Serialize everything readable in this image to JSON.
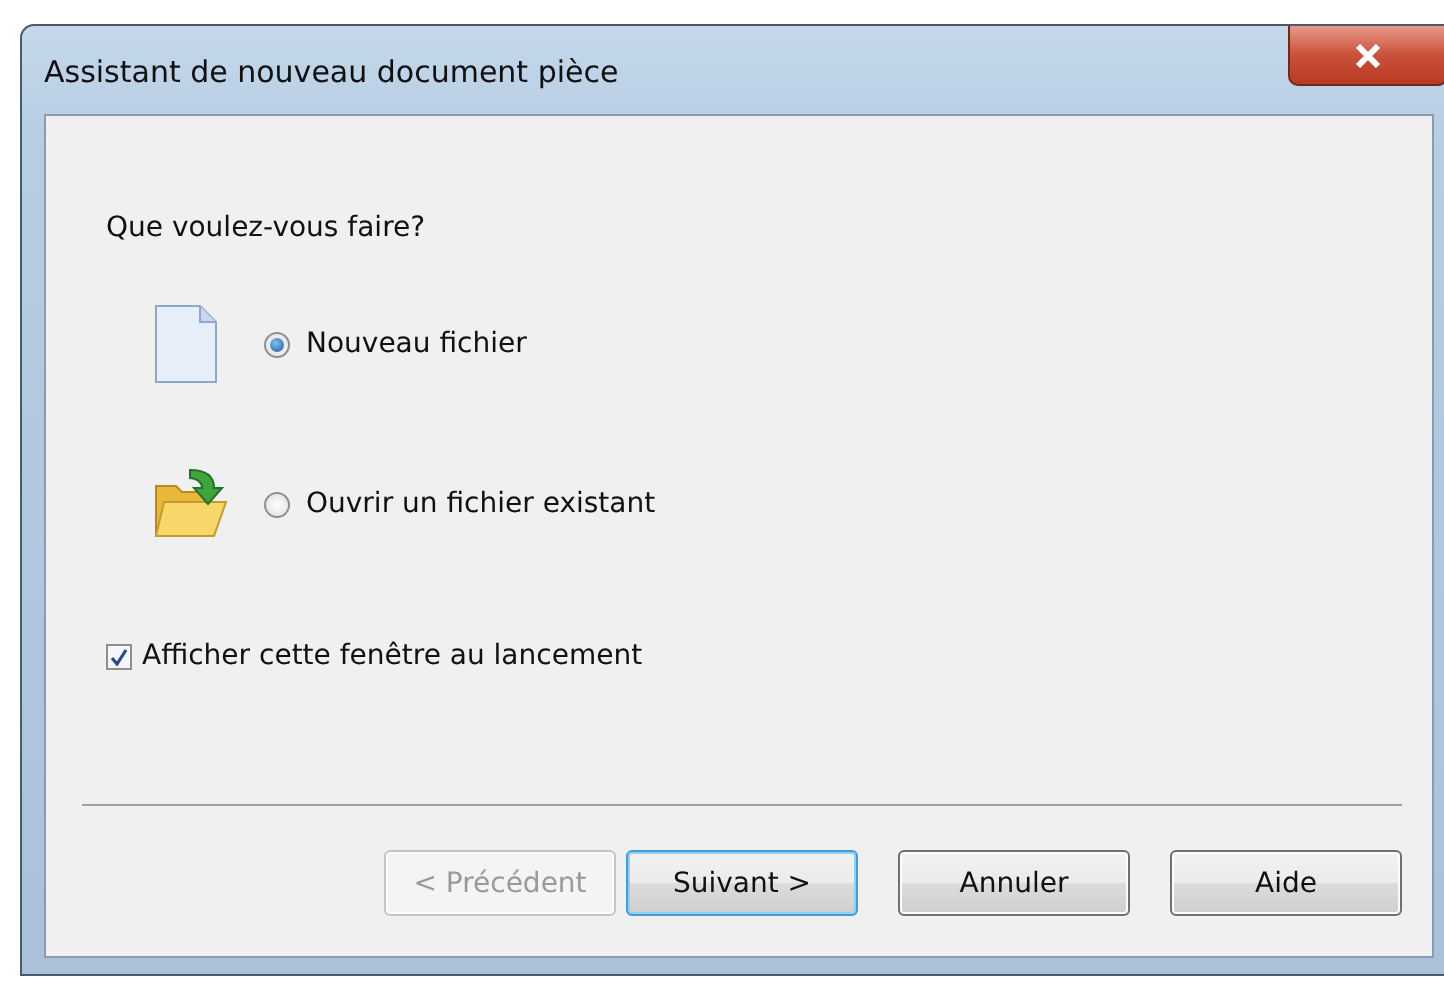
{
  "window": {
    "title": "Assistant de nouveau document pièce"
  },
  "prompt": "Que voulez-vous faire?",
  "options": [
    {
      "label": "Nouveau fichier",
      "kind": "new",
      "selected": true
    },
    {
      "label": "Ouvrir un fichier existant",
      "kind": "open",
      "selected": false
    }
  ],
  "show_at_startup": {
    "label": "Afficher cette fenêtre au lancement",
    "checked": true
  },
  "buttons": [
    {
      "label": "< Précédent",
      "disabled": true,
      "default": false
    },
    {
      "label": "Suivant >",
      "disabled": false,
      "default": true
    },
    {
      "label": "Annuler",
      "disabled": false,
      "default": false
    },
    {
      "label": "Aide",
      "disabled": false,
      "default": false
    }
  ]
}
